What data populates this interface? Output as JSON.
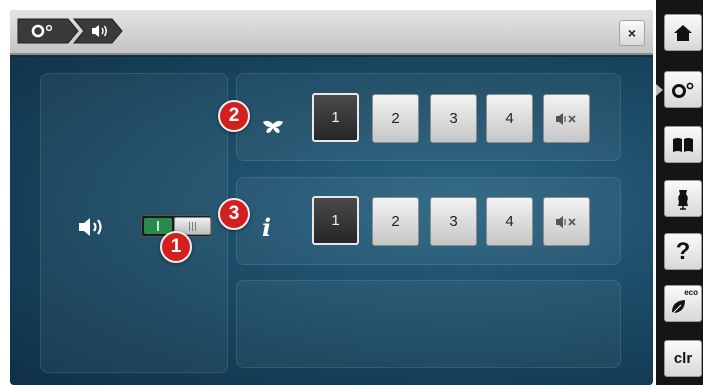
{
  "breadcrumb": {
    "items": [
      {
        "icon": "settings-icon"
      },
      {
        "icon": "audio-settings-icon"
      }
    ]
  },
  "window": {
    "close_label": "×"
  },
  "audio": {
    "speaker_icon": "speaker-icon",
    "toggle_state": "on"
  },
  "callouts": {
    "toggle": "1",
    "stitch_sound": "2",
    "info_sound": "3"
  },
  "rows": [
    {
      "icon": "butterfly-icon",
      "levels": [
        "1",
        "2",
        "3",
        "4"
      ],
      "selected": "1",
      "mute_icon": "mute-icon"
    },
    {
      "icon": "info-icon",
      "icon_text": "i",
      "levels": [
        "1",
        "2",
        "3",
        "4"
      ],
      "selected": "1",
      "mute_icon": "mute-icon"
    }
  ],
  "sidebar": {
    "items": [
      {
        "icon": "home-icon"
      },
      {
        "icon": "settings-icon"
      },
      {
        "icon": "book-icon"
      },
      {
        "icon": "dress-form-icon"
      },
      {
        "icon": "help-icon",
        "label": "?"
      },
      {
        "icon": "eco-icon",
        "label": "eco"
      },
      {
        "icon": "clear-icon",
        "label": "clr"
      }
    ]
  },
  "colors": {
    "background": "#184660",
    "callout": "#d3201f",
    "toggle_on": "#2c8a4e"
  }
}
